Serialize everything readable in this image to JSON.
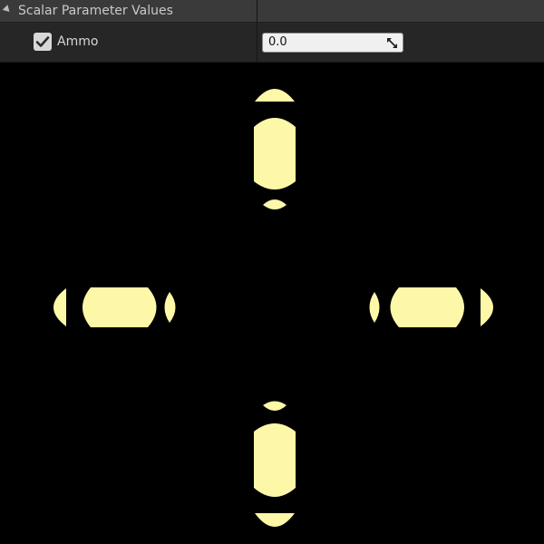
{
  "panel": {
    "category_title": "Scalar Parameter Values",
    "parameter": {
      "name": "Ammo",
      "enabled": true,
      "value": "0.0"
    }
  },
  "preview": {
    "shape_color": "#fdf8a8",
    "background_color": "#000000"
  }
}
